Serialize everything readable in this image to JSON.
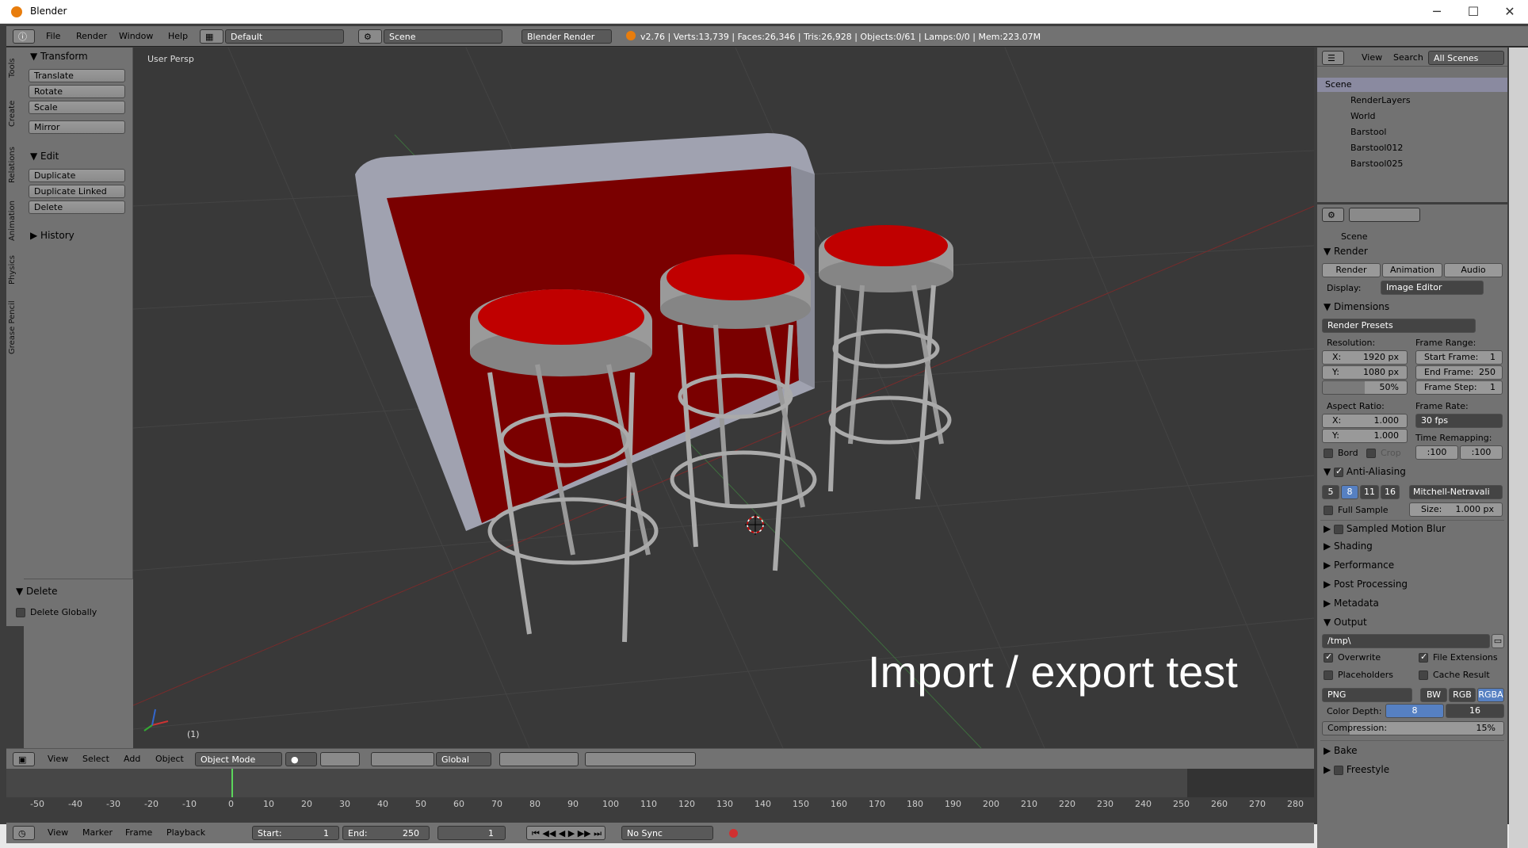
{
  "window": {
    "title": "Blender",
    "controls": [
      "─",
      "☐",
      "✕"
    ]
  },
  "infobar": {
    "menus": [
      "File",
      "Render",
      "Window",
      "Help"
    ],
    "layout": "Default",
    "scene": "Scene",
    "engine": "Blender Render",
    "stats": "v2.76 | Verts:13,739 | Faces:26,346 | Tris:26,928 | Objects:0/61 | Lamps:0/0 | Mem:223.07M"
  },
  "vtabs": [
    "Tools",
    "Create",
    "Relations",
    "Animation",
    "Physics",
    "Grease Pencil"
  ],
  "toolshelf": {
    "transform": {
      "title": "Transform",
      "buttons": [
        "Translate",
        "Rotate",
        "Scale",
        "Mirror"
      ]
    },
    "edit": {
      "title": "Edit",
      "buttons": [
        "Duplicate",
        "Duplicate Linked",
        "Delete"
      ]
    },
    "history": {
      "title": "History"
    },
    "operator": {
      "title": "Delete",
      "option": "Delete Globally"
    }
  },
  "viewport": {
    "view_name": "User Persp",
    "overlay_text": "Import / export test",
    "frame": "(1)"
  },
  "view3d_header": {
    "menus": [
      "View",
      "Select",
      "Add",
      "Object"
    ],
    "mode": "Object Mode",
    "orientation": "Global"
  },
  "timeline": {
    "ticks": [
      "-50",
      "-40",
      "-30",
      "-20",
      "-10",
      "0",
      "10",
      "20",
      "30",
      "40",
      "50",
      "60",
      "70",
      "80",
      "90",
      "100",
      "110",
      "120",
      "130",
      "140",
      "150",
      "160",
      "170",
      "180",
      "190",
      "200",
      "210",
      "220",
      "230",
      "240",
      "250",
      "260",
      "270",
      "280"
    ],
    "menus": [
      "View",
      "Marker",
      "Frame",
      "Playback"
    ],
    "start_label": "Start:",
    "start": "1",
    "end_label": "End:",
    "end": "250",
    "current": "1",
    "sync": "No Sync"
  },
  "outliner": {
    "menus": [
      "View",
      "Search"
    ],
    "display": "All Scenes",
    "items": [
      "Scene",
      "RenderLayers",
      "World",
      "Barstool",
      "Barstool012",
      "Barstool025"
    ]
  },
  "properties": {
    "context": "Scene",
    "render_panel": "Render",
    "render_buttons": [
      "Render",
      "Animation",
      "Audio"
    ],
    "display_label": "Display:",
    "display_value": "Image Editor",
    "dimensions": "Dimensions",
    "presets": "Render Presets",
    "resolution_label": "Resolution:",
    "res_x": "X:",
    "res_x_val": "1920 px",
    "res_y": "Y:",
    "res_y_val": "1080 px",
    "res_pct": "50%",
    "frame_range_label": "Frame Range:",
    "start_frame": "Start Frame:",
    "start_frame_val": "1",
    "end_frame": "End Frame:",
    "end_frame_val": "250",
    "frame_step": "Frame Step:",
    "frame_step_val": "1",
    "aspect_label": "Aspect Ratio:",
    "asp_x": "X:",
    "asp_x_val": "1.000",
    "asp_y": "Y:",
    "asp_y_val": "1.000",
    "frame_rate_label": "Frame Rate:",
    "frame_rate": "30 fps",
    "time_remap_label": "Time Remapping:",
    "remap_old": ":100",
    "remap_new": ":100",
    "bord": "Bord",
    "crop": "Crop",
    "aa": "Anti-Aliasing",
    "aa_samples": [
      "5",
      "8",
      "11",
      "16"
    ],
    "aa_filter": "Mitchell-Netravali",
    "full_sample": "Full Sample",
    "aa_size": "Size:",
    "aa_size_val": "1.000 px",
    "collapsed": [
      "Sampled Motion Blur",
      "Shading",
      "Performance",
      "Post Processing",
      "Metadata"
    ],
    "output": "Output",
    "output_path": "/tmp\\",
    "overwrite": "Overwrite",
    "file_ext": "File Extensions",
    "placeholders": "Placeholders",
    "cache_result": "Cache Result",
    "format": "PNG",
    "color_modes": [
      "BW",
      "RGB",
      "RGBA"
    ],
    "color_depth_label": "Color Depth:",
    "depths": [
      "8",
      "16"
    ],
    "compression": "Compression:",
    "compression_val": "15%",
    "bake": "Bake",
    "freestyle": "Freestyle"
  }
}
